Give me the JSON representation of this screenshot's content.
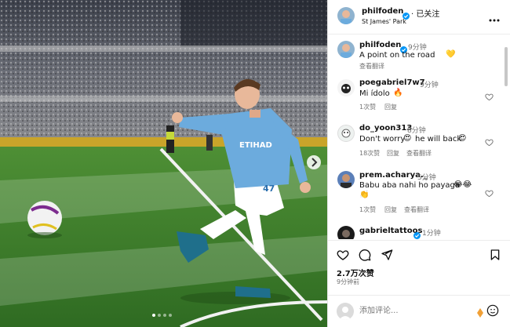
{
  "post": {
    "author": "philfoden",
    "follow_label": "· 已关注",
    "location": "St James' Park",
    "likes": "2.7万次赞",
    "time": "9分钟前",
    "carousel_dots": 4
  },
  "caption": {
    "author": "philfoden",
    "time": "9分钟",
    "text": "A point on the road",
    "emoji": "💛",
    "translate": "查看翻译"
  },
  "comments": [
    {
      "user": "poegabriel7w7",
      "time": "9分钟",
      "text": "Mi ídolo",
      "emoji": "🔥",
      "likes": "1次赞",
      "reply": "回复",
      "translate": "",
      "verified": false
    },
    {
      "user": "do_yoon313",
      "time": "8分钟",
      "text": "Don't worry",
      "emoji": "😍",
      "text2": "he will back",
      "emoji2": "😍",
      "likes": "18次赞",
      "reply": "回复",
      "translate": "查看翻译",
      "verified": false
    },
    {
      "user": "prem.acharya._",
      "time": "5分钟",
      "text": "Babu aba nahi ho payaga",
      "emoji": "😂😂",
      "emoji_line2": "👏",
      "likes": "1次赞",
      "reply": "回复",
      "translate": "查看翻译",
      "verified": false
    },
    {
      "user": "gabrieltattoos",
      "time": "1分钟",
      "text": "",
      "verified": true
    }
  ],
  "add_comment": {
    "placeholder": "添加评论..."
  },
  "colors": {
    "verified": "#0095f6",
    "sky_blue": "#6cabdd",
    "pitch": "#3b7a2b"
  }
}
